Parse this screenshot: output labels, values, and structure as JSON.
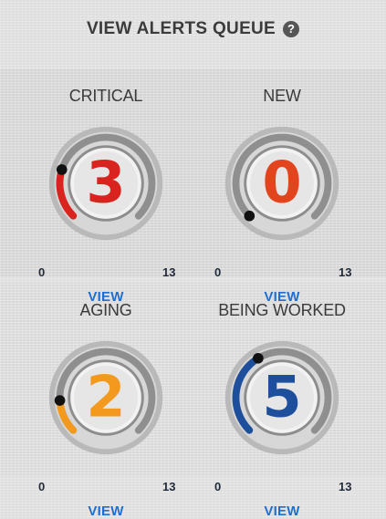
{
  "header": {
    "title": "VIEW ALERTS QUEUE",
    "help_icon": "question-icon"
  },
  "widgets": [
    {
      "id": "critical",
      "label": "CRITICAL",
      "count": "3",
      "value": 3,
      "min": "0",
      "max": "13",
      "link": "VIEW",
      "color": "#d8231f"
    },
    {
      "id": "new",
      "label": "NEW",
      "count": "0",
      "value": 0,
      "min": "0",
      "max": "13",
      "link": "VIEW",
      "color": "#e2451d"
    },
    {
      "id": "aging",
      "label": "AGING",
      "count": "2",
      "value": 2,
      "min": "0",
      "max": "13",
      "link": "VIEW",
      "color": "#f39a1e"
    },
    {
      "id": "being-worked",
      "label": "BEING WORKED",
      "count": "5",
      "value": 5,
      "min": "0",
      "max": "13",
      "link": "VIEW",
      "color": "#1d4f9c"
    }
  ]
}
